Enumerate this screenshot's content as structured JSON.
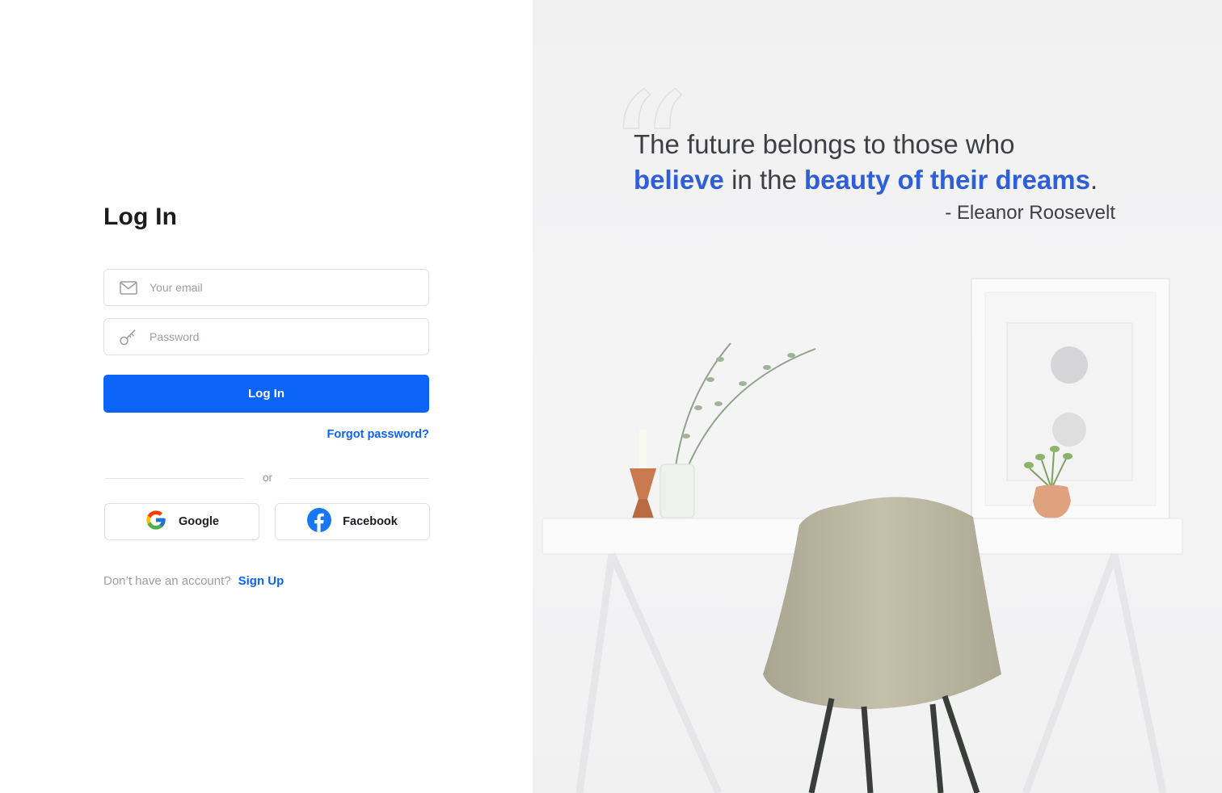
{
  "login": {
    "title": "Log In",
    "email_placeholder": "Your email",
    "password_placeholder": "Password",
    "submit_label": "Log In",
    "forgot_label": "Forgot password?",
    "divider_label": "or",
    "google_label": "Google",
    "facebook_label": "Facebook",
    "no_account_text": "Don’t have an account?",
    "signup_label": "Sign Up"
  },
  "quote": {
    "line1": "The future belongs to those who",
    "word_believe": "believe",
    "middle": " in the ",
    "phrase_beauty": "beauty of their dreams",
    "period": ".",
    "author": "- Eleanor Roosevelt"
  },
  "colors": {
    "accent": "#0b64f8",
    "quote_highlight": "#2e5ed8",
    "text_dark": "#1b1b22",
    "muted": "#9a9dab"
  },
  "icons": [
    "mail-icon",
    "key-icon",
    "google-icon",
    "facebook-icon",
    "quote-mark-icon"
  ]
}
